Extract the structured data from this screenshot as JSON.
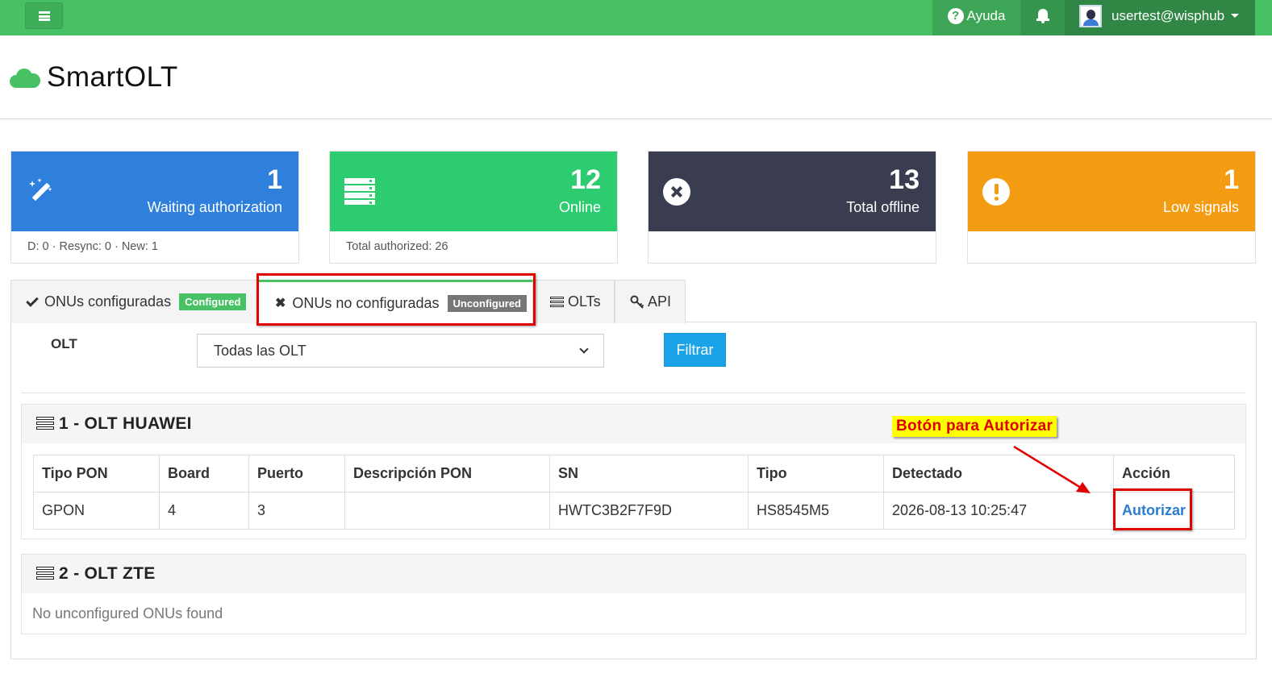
{
  "topbar": {
    "help_label": "Ayuda",
    "user_label": "usertest@wisphub"
  },
  "brand": {
    "name": "SmartOLT"
  },
  "stats": [
    {
      "value": "1",
      "label": "Waiting authorization",
      "footer": "D: 0 · Resync: 0 · New: 1",
      "color": "#2f7fdd",
      "icon": "magic-wand-icon"
    },
    {
      "value": "12",
      "label": "Online",
      "footer": "Total authorized: 26",
      "color": "#2ecc71",
      "icon": "server-stack-icon"
    },
    {
      "value": "13",
      "label": "Total offline",
      "footer": "",
      "color": "#3a3d4f",
      "icon": "circle-x-icon"
    },
    {
      "value": "1",
      "label": "Low signals",
      "footer": "",
      "color": "#f39c12",
      "icon": "exclamation-circle-icon"
    }
  ],
  "tabs": [
    {
      "label": "ONUs configuradas",
      "badge": "Configured",
      "badge_color": "#48c165"
    },
    {
      "label": "ONUs no configuradas",
      "badge": "Unconfigured",
      "badge_color": "#777777"
    },
    {
      "label": "OLTs"
    },
    {
      "label": "API"
    }
  ],
  "filter": {
    "olt_label": "OLT",
    "olt_selected": "Todas las OLT",
    "button": "Filtrar"
  },
  "olts": [
    {
      "title": "1 - OLT HUAWEI",
      "columns": [
        "Tipo PON",
        "Board",
        "Puerto",
        "Descripción PON",
        "SN",
        "Tipo",
        "Detectado",
        "Acción"
      ],
      "rows": [
        {
          "pon_type": "GPON",
          "board": "4",
          "port": "3",
          "description": "",
          "sn": "HWTC3B2F7F9D",
          "type": "HS8545M5",
          "detected": "2026-08-13 10:25:47",
          "action": "Autorizar"
        }
      ]
    },
    {
      "title": "2 - OLT ZTE",
      "empty_message": "No unconfigured ONUs found"
    }
  ],
  "annotation": {
    "text": "Botón para Autorizar"
  }
}
